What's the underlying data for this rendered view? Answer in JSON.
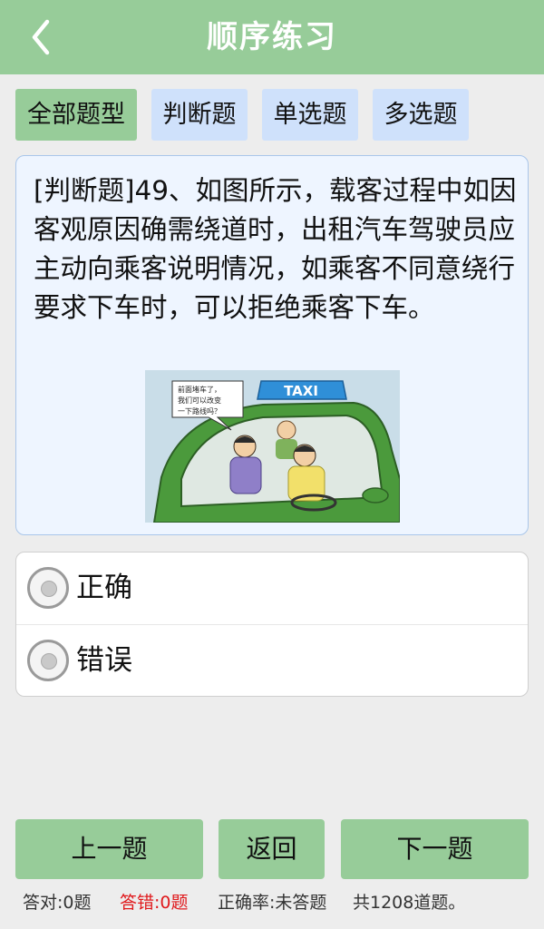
{
  "header": {
    "title": "顺序练习",
    "back_icon": "chevron-left-icon"
  },
  "filters": [
    {
      "label": "全部题型",
      "active": true
    },
    {
      "label": "判断题",
      "active": false
    },
    {
      "label": "单选题",
      "active": false
    },
    {
      "label": "多选题",
      "active": false
    }
  ],
  "question": {
    "text": "[判断题]49、如图所示，载客过程中如因客观原因确需绕道时，出租汽车驾驶员应主动向乘客说明情况，如乘客不同意绕行要求下车时，可以拒绝乘客下车。",
    "image": {
      "sign_text": "TAXI",
      "speech_lines": [
        "前面堵车了，",
        "我们可以改变",
        "一下路线吗？"
      ]
    }
  },
  "options": [
    {
      "label": "正确",
      "selected": false
    },
    {
      "label": "错误",
      "selected": false
    }
  ],
  "nav": {
    "prev_label": "上一题",
    "back_label": "返回",
    "next_label": "下一题"
  },
  "status": {
    "correct": "答对:0题",
    "wrong": "答错:0题",
    "rate": "正确率:未答题",
    "total": "共1208道题。"
  },
  "colors": {
    "accent_green": "#97cc99",
    "tab_blue": "#cfe1fb",
    "card_bg": "#eef5ff",
    "wrong_red": "#e0191c"
  }
}
